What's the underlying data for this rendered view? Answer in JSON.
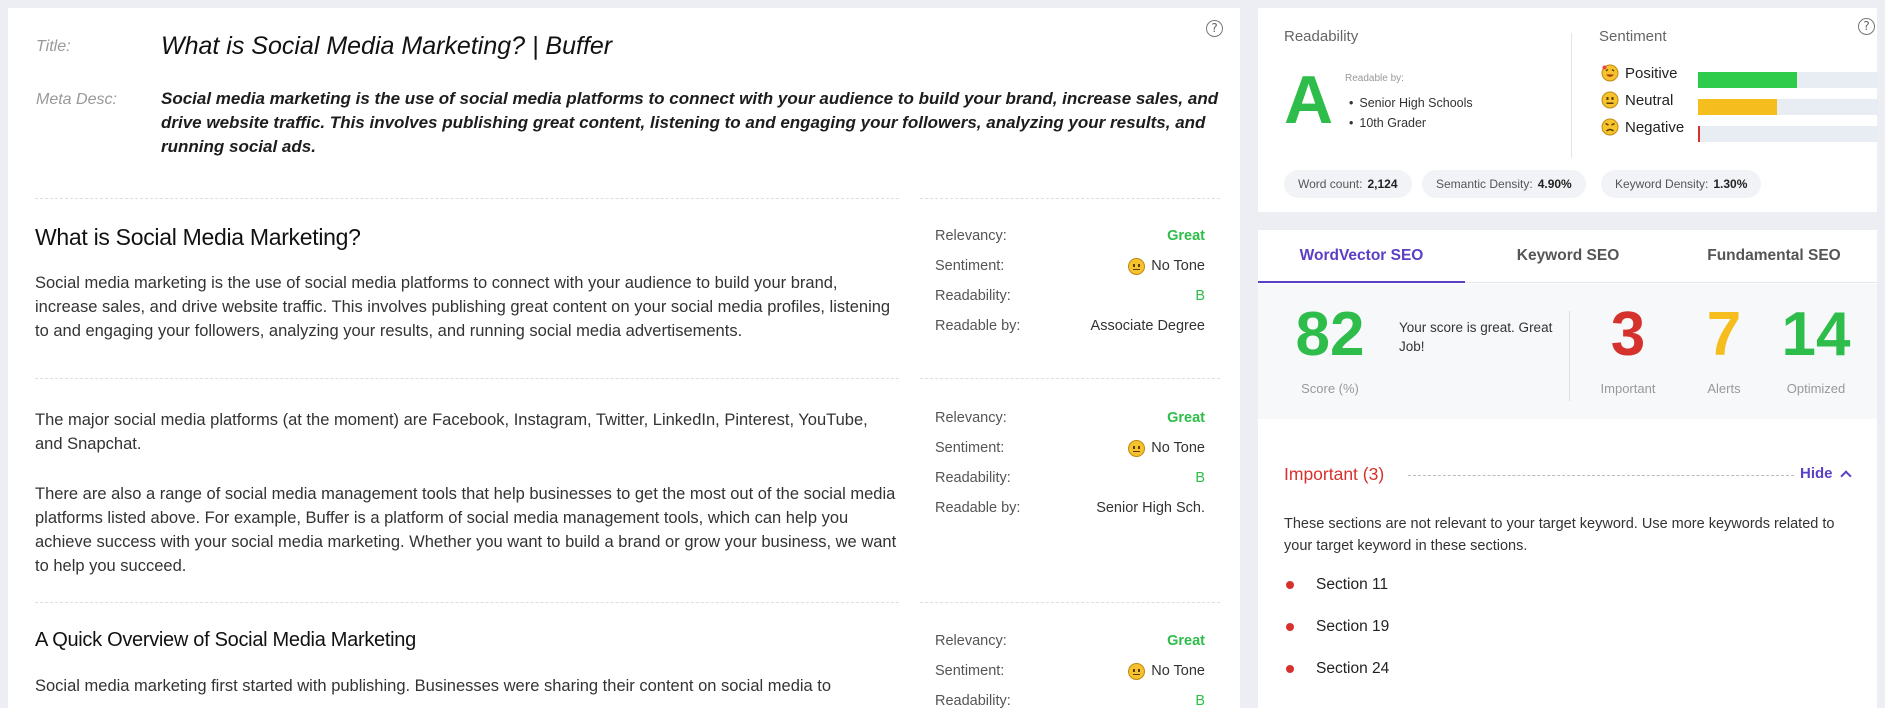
{
  "meta": {
    "title_label": "Title:",
    "title": "What is Social Media Marketing? | Buffer",
    "desc_label": "Meta Desc:",
    "desc": "Social media marketing is the use of social media platforms to connect with your audience to build your brand, increase sales, and drive website traffic. This involves publishing great content, listening to and engaging your followers, analyzing your results, and running social ads."
  },
  "help_glyph": "?",
  "metric_labels": {
    "relevancy": "Relevancy:",
    "sentiment": "Sentiment:",
    "readability": "Readability:",
    "readable_by": "Readable by:"
  },
  "sections": [
    {
      "heading": "What is Social Media Marketing?",
      "paragraphs": [
        "Social media marketing is the use of social media platforms to connect with your audience to build your brand, increase sales, and drive website traffic. This involves publishing great content on your social media profiles, listening to and engaging your followers, analyzing your results, and running social media advertisements."
      ],
      "relevancy": "Great",
      "sentiment": "No Tone",
      "readability": "B",
      "readable_by": "Associate Degree"
    },
    {
      "heading": "",
      "paragraphs": [
        "The major social media platforms (at the moment) are Facebook, Instagram, Twitter, LinkedIn, Pinterest, YouTube, and Snapchat.",
        "There are also a range of social media management tools that help businesses to get the most out of the social media platforms listed above. For example, Buffer is a platform of social media management tools, which can help you achieve success with your social media marketing. Whether you want to build a brand or grow your business, we want to help you succeed."
      ],
      "relevancy": "Great",
      "sentiment": "No Tone",
      "readability": "B",
      "readable_by": "Senior High Sch."
    },
    {
      "heading": "A Quick Overview of Social Media Marketing",
      "paragraphs": [
        "Social media marketing first started with publishing. Businesses were sharing their content on social media to"
      ],
      "relevancy": "Great",
      "sentiment": "No Tone",
      "readability": "B",
      "readable_by": ""
    }
  ],
  "readability": {
    "label": "Readability",
    "grade": "A",
    "readable_by_label": "Readable by:",
    "audiences": [
      "Senior High Schools",
      "10th Grader"
    ]
  },
  "sentiment": {
    "label": "Sentiment",
    "rows": [
      {
        "label": "Positive",
        "icon": "happy-face-icon",
        "value": 0.55,
        "color": "#2ecc4a"
      },
      {
        "label": "Neutral",
        "icon": "neutral-face-icon",
        "value": 0.44,
        "color": "#f6bd1e"
      },
      {
        "label": "Negative",
        "icon": "angry-face-icon",
        "value": 0.01,
        "color": "#d6322d"
      }
    ]
  },
  "stats": [
    {
      "label": "Word count:",
      "value": "2,124"
    },
    {
      "label": "Semantic Density:",
      "value": "4.90%"
    },
    {
      "label": "Keyword Density:",
      "value": "1.30%"
    }
  ],
  "tabs": [
    "WordVector SEO",
    "Keyword SEO",
    "Fundamental SEO"
  ],
  "active_tab": "WordVector SEO",
  "score": {
    "value": "82",
    "caption": "Score (%)",
    "message": "Your score is great. Great Job!",
    "important": "3",
    "important_label": "Important",
    "alerts": "7",
    "alerts_label": "Alerts",
    "optimized": "14",
    "optimized_label": "Optimized"
  },
  "important": {
    "heading": "Important (3)",
    "hide_label": "Hide",
    "description": "These sections are not relevant to your target keyword. Use more keywords related to your target keyword in these sections.",
    "items": [
      "Section 11",
      "Section 19",
      "Section 24"
    ]
  },
  "colors": {
    "accent": "#5b3fc4",
    "green": "#2ebd4a",
    "red": "#d6322d",
    "yellow": "#f6bd1e"
  }
}
